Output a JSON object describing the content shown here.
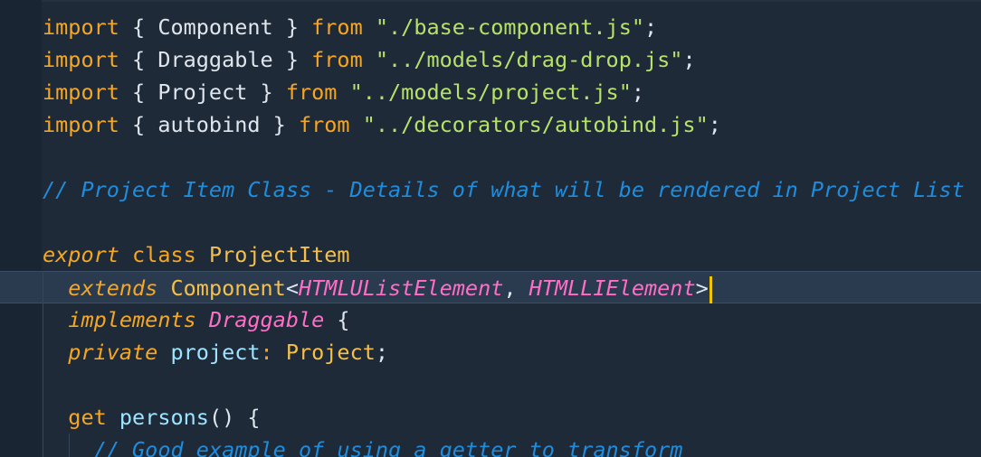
{
  "editor": {
    "colors": {
      "background": "#1f2a38",
      "keyword": "#f5a623",
      "string": "#b7e26a",
      "comment": "#1f8dde",
      "type": "#ff6ec7",
      "identifier": "#dfe6ee",
      "class_name": "#f5c04a",
      "property": "#9de4ff",
      "cursor": "#f0c500"
    },
    "lines": [
      {
        "tokens": [
          {
            "t": "import",
            "c": "kw"
          },
          {
            "t": " { Component } ",
            "c": "plain"
          },
          {
            "t": "from",
            "c": "kw"
          },
          {
            "t": " ",
            "c": "plain"
          },
          {
            "t": "\"./base-component.js\"",
            "c": "str"
          },
          {
            "t": ";",
            "c": "plain"
          }
        ]
      },
      {
        "tokens": [
          {
            "t": "import",
            "c": "kw"
          },
          {
            "t": " { Draggable } ",
            "c": "plain"
          },
          {
            "t": "from",
            "c": "kw"
          },
          {
            "t": " ",
            "c": "plain"
          },
          {
            "t": "\"../models/drag-drop.js\"",
            "c": "str"
          },
          {
            "t": ";",
            "c": "plain"
          }
        ]
      },
      {
        "tokens": [
          {
            "t": "import",
            "c": "kw"
          },
          {
            "t": " { Project } ",
            "c": "plain"
          },
          {
            "t": "from",
            "c": "kw"
          },
          {
            "t": " ",
            "c": "plain"
          },
          {
            "t": "\"../models/project.js\"",
            "c": "str"
          },
          {
            "t": ";",
            "c": "plain"
          }
        ]
      },
      {
        "tokens": [
          {
            "t": "import",
            "c": "kw"
          },
          {
            "t": " { autobind } ",
            "c": "plain"
          },
          {
            "t": "from",
            "c": "kw"
          },
          {
            "t": " ",
            "c": "plain"
          },
          {
            "t": "\"../decorators/autobind.js\"",
            "c": "str"
          },
          {
            "t": ";",
            "c": "plain"
          }
        ]
      },
      {
        "tokens": []
      },
      {
        "tokens": [
          {
            "t": "// Project Item Class - Details of what will be rendered in Project List",
            "c": "cmt"
          }
        ]
      },
      {
        "tokens": []
      },
      {
        "tokens": [
          {
            "t": "export",
            "c": "kw ital"
          },
          {
            "t": " ",
            "c": "plain"
          },
          {
            "t": "class",
            "c": "kw"
          },
          {
            "t": " ",
            "c": "plain"
          },
          {
            "t": "ProjectItem",
            "c": "cls"
          }
        ]
      },
      {
        "active": true,
        "tokens": [
          {
            "t": "  ",
            "c": "plain"
          },
          {
            "t": "extends",
            "c": "kw ital"
          },
          {
            "t": " ",
            "c": "plain"
          },
          {
            "t": "Component",
            "c": "cls"
          },
          {
            "t": "<",
            "c": "plain"
          },
          {
            "t": "HTMLUListElement",
            "c": "type"
          },
          {
            "t": ", ",
            "c": "plain"
          },
          {
            "t": "HTMLLIElement",
            "c": "type"
          },
          {
            "t": ">",
            "c": "plain"
          }
        ]
      },
      {
        "tokens": [
          {
            "t": "  ",
            "c": "plain"
          },
          {
            "t": "implements",
            "c": "kw ital"
          },
          {
            "t": " ",
            "c": "plain"
          },
          {
            "t": "Draggable",
            "c": "type"
          },
          {
            "t": " {",
            "c": "plain"
          }
        ]
      },
      {
        "tokens": [
          {
            "t": "  ",
            "c": "plain"
          },
          {
            "t": "private",
            "c": "kw ital"
          },
          {
            "t": " ",
            "c": "plain"
          },
          {
            "t": "project",
            "c": "prop"
          },
          {
            "t": ": ",
            "c": "kw"
          },
          {
            "t": "Project",
            "c": "cls"
          },
          {
            "t": ";",
            "c": "plain"
          }
        ]
      },
      {
        "tokens": []
      },
      {
        "tokens": [
          {
            "t": "  ",
            "c": "plain"
          },
          {
            "t": "get",
            "c": "kw"
          },
          {
            "t": " ",
            "c": "plain"
          },
          {
            "t": "persons",
            "c": "prop"
          },
          {
            "t": "() {",
            "c": "plain"
          }
        ]
      },
      {
        "tokens": [
          {
            "t": "    ",
            "c": "plain"
          },
          {
            "t": "// Good example of using a getter to transform",
            "c": "cmt"
          }
        ]
      }
    ]
  }
}
